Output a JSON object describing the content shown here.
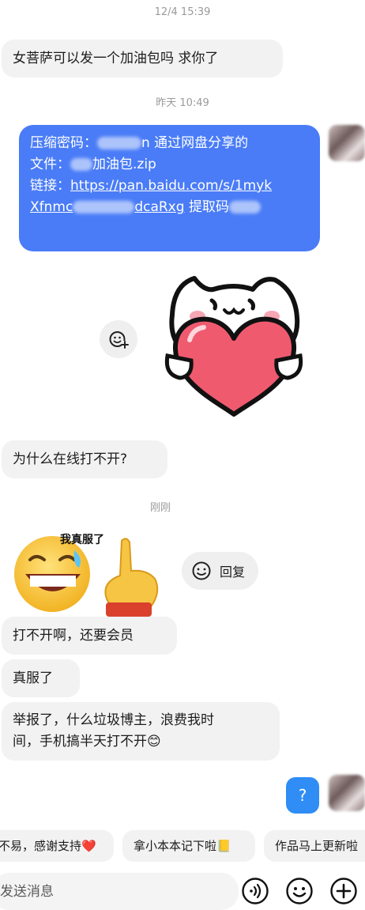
{
  "timestamps": {
    "first": "12/4 15:39",
    "second": "昨天 10:49",
    "third": "刚刚"
  },
  "messages": {
    "m1": "女菩萨可以发一个加油包吗 求你了",
    "share": {
      "line1_label": "压缩密码：",
      "line1_suffix": "n 通过网盘分享的",
      "line2_prefix": "文件：",
      "line2_suffix": "加油包.zip",
      "line3_label": "链接：",
      "line3_link": "https://pan.baidu.com/s/1myk",
      "line4_prefix": "Xfnmc",
      "line4_mid": "dcaRxg",
      "line4_suffix": "提取码"
    },
    "m3": "为什么在线打不开?",
    "sticker_caption": "我真服了",
    "m4": "打不开啊，还要会员",
    "m5": "真服了",
    "m6_line1": "举报了，什么垃圾博主，浪费我时",
    "m6_line2": "间，手机搞半天打不开😊",
    "outgoing": "?"
  },
  "reply_button": {
    "label": "回复"
  },
  "quick_replies": [
    {
      "label": "不易，感谢支持❤️"
    },
    {
      "label": "拿小本本记下啦📒"
    },
    {
      "label": "作品马上更新啦"
    }
  ],
  "composer": {
    "placeholder": "发送消息"
  },
  "colors": {
    "share_bubble": "#4a7cf7",
    "outgoing_bubble": "#2f8df5",
    "incoming_bubble": "#f2f2f2"
  },
  "icons": [
    "add-emoji-icon",
    "smile-icon",
    "voice-icon",
    "emoji-icon",
    "plus-icon"
  ]
}
